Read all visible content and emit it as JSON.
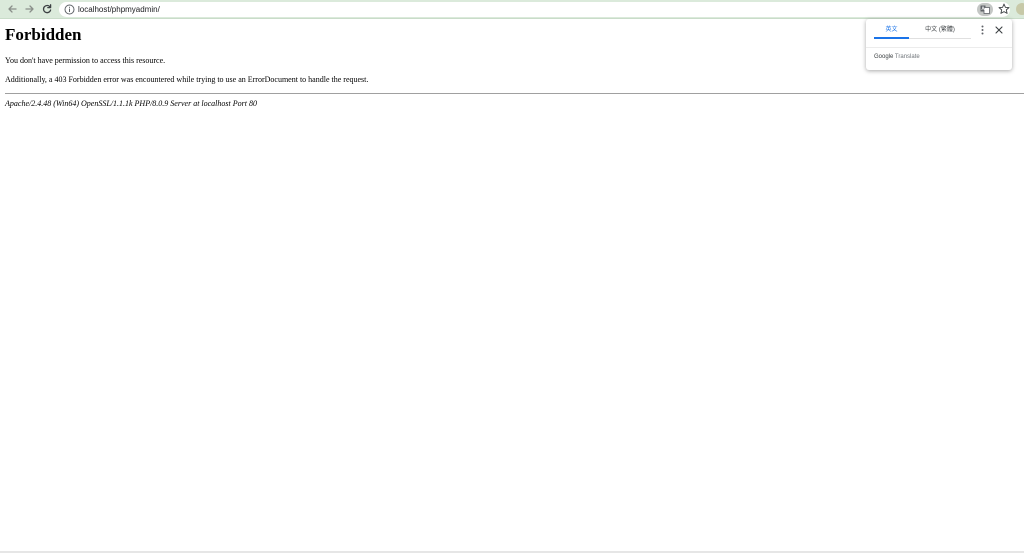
{
  "browser": {
    "url": "localhost/phpmyadmin/",
    "colors": {
      "toolbar_bg": "#dbeadb",
      "omnibox_bg": "#ffffff"
    },
    "icons": {
      "back": "back-arrow-icon",
      "forward": "forward-arrow-icon",
      "reload": "reload-icon",
      "site_info": "info-icon",
      "translate": "translate-icon",
      "bookmark": "star-icon"
    }
  },
  "page": {
    "title": "Forbidden",
    "message": "You don't have permission to access this resource.",
    "additional": "Additionally, a 403 Forbidden error was encountered while trying to use an ErrorDocument to handle the request.",
    "server_signature": "Apache/2.4.48 (Win64) OpenSSL/1.1.1k PHP/8.0.9 Server at localhost Port 80"
  },
  "translate_popup": {
    "tabs": [
      {
        "label": "英文",
        "active": true
      },
      {
        "label": "中文 (繁體)",
        "active": false
      }
    ],
    "branding_google": "Google",
    "branding_translate": " Translate",
    "accent_color": "#1a73e8",
    "icons": {
      "menu": "more-vert-icon",
      "close": "close-icon"
    }
  }
}
